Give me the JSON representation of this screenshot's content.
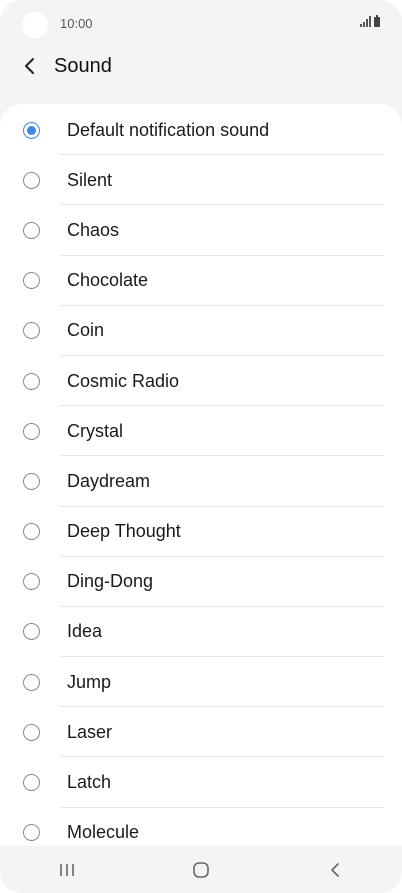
{
  "status_bar": {
    "time": "10:00",
    "icons": [
      "camera-dot",
      "signal-icon",
      "battery-icon"
    ]
  },
  "header": {
    "title": "Sound",
    "back_icon": "chevron-left-icon"
  },
  "sound_list": {
    "selected": "Default notification sound",
    "items": [
      {
        "label": "Default notification sound",
        "checked": true
      },
      {
        "label": "Silent",
        "checked": false
      },
      {
        "label": "Chaos",
        "checked": false
      },
      {
        "label": "Chocolate",
        "checked": false
      },
      {
        "label": "Coin",
        "checked": false
      },
      {
        "label": "Cosmic Radio",
        "checked": false
      },
      {
        "label": "Crystal",
        "checked": false
      },
      {
        "label": "Daydream",
        "checked": false
      },
      {
        "label": "Deep Thought",
        "checked": false
      },
      {
        "label": "Ding-Dong",
        "checked": false
      },
      {
        "label": "Idea",
        "checked": false
      },
      {
        "label": "Jump",
        "checked": false
      },
      {
        "label": "Laser",
        "checked": false
      },
      {
        "label": "Latch",
        "checked": false
      },
      {
        "label": "Molecule",
        "checked": false
      }
    ]
  },
  "nav_bar": {
    "icons": [
      "recent-apps-icon",
      "home-icon",
      "back-icon"
    ]
  },
  "colors": {
    "accent": "#3e86e6",
    "background": "#f4f4f6",
    "card": "#ffffff"
  }
}
